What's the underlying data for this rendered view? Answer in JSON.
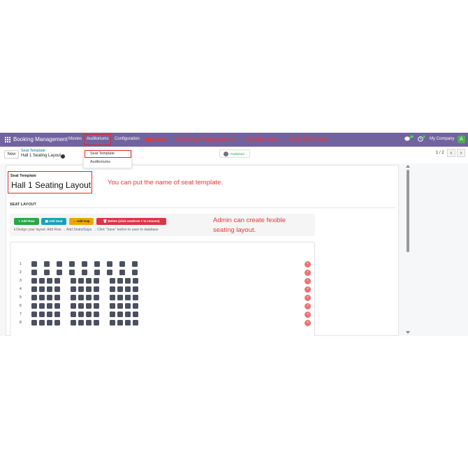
{
  "navbar": {
    "brand": "Booking Management",
    "menu": [
      "Movies",
      "Auditoriums",
      "Configuration"
    ],
    "annotation": "Booking Management → Auditoriums → Seat Template",
    "chat_count": "10",
    "activity_count": "2",
    "company": "My Company",
    "avatar_letter": "A"
  },
  "control": {
    "new_label": "New",
    "breadcrumb_parent": "Seat Template",
    "record_name": "Hall 1 Seating Layout",
    "published_label": "Published",
    "pager": "1 / 2",
    "prev_label": "‹",
    "next_label": "›"
  },
  "dropdown": {
    "items": [
      "Seat Template",
      "Auditoriums"
    ]
  },
  "form": {
    "field_label": "Seat Template",
    "field_value": "Hall 1 Seating Layout",
    "annotation_1": "You can put the name of seat template.",
    "section_title": "SEAT LAYOUT",
    "annotation_2_line1": "Admin can create fexible",
    "annotation_2_line2": "seating layout.",
    "buttons": {
      "add_row": "+ Add Row",
      "add_seat": "▦ Add Seat",
      "add_gap": "↔ Add Gap",
      "delete": "🗑 Delete (click seat/row × to remove)"
    },
    "hint": "ℹ Design your layout: Add Row → Add Seats/Gaps → Click \"Save\" button to save to database"
  },
  "seat_layout": {
    "rows": [
      "1",
      "2",
      "3",
      "4",
      "5",
      "6",
      "7",
      "8"
    ],
    "remove_label": "×"
  },
  "colors": {
    "navbar": "#71639e",
    "annotation": "#e53935",
    "seat": "#4a5060",
    "remove": "#ee7070"
  }
}
